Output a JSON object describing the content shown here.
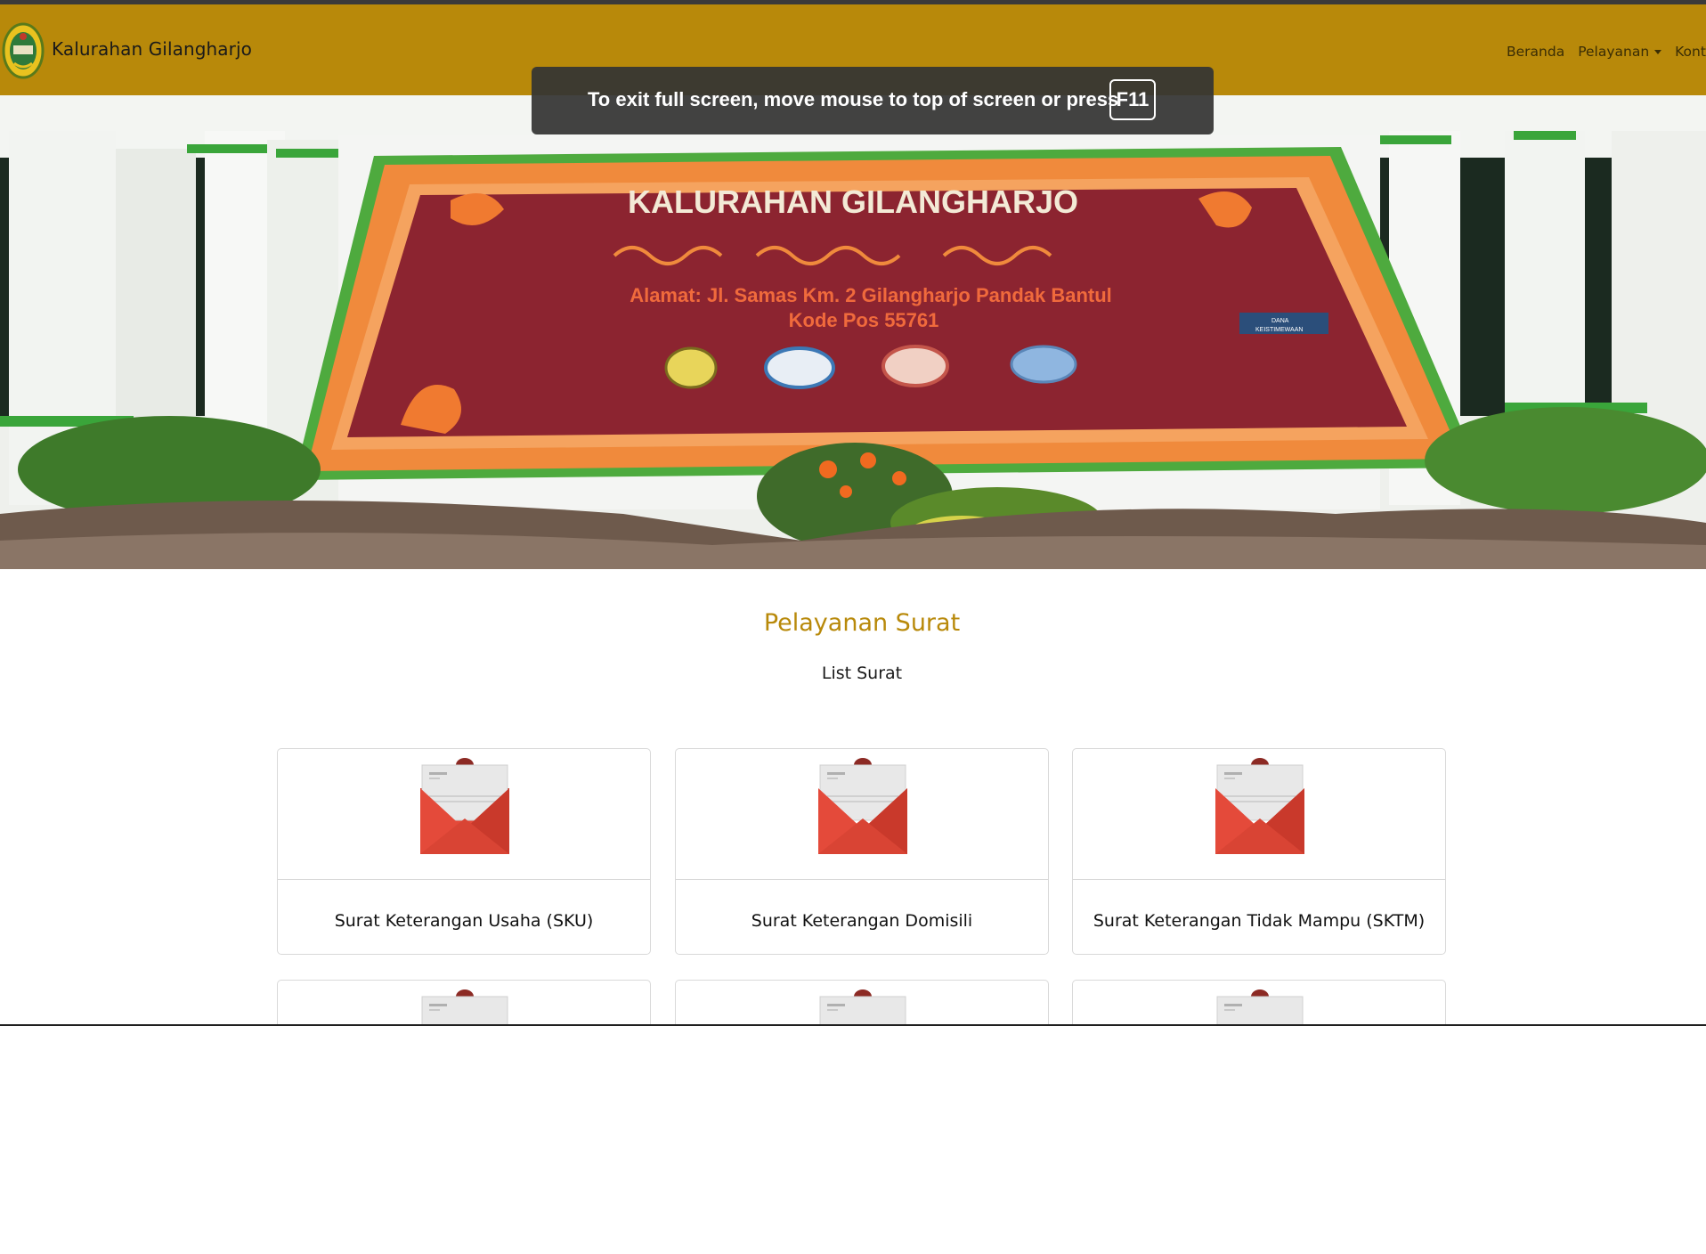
{
  "browser": {
    "fullscreen_notice": {
      "message": "To exit full screen, move mouse to top of screen or press",
      "key": "F11"
    }
  },
  "navbar": {
    "brand": "Kalurahan Gilangharjo",
    "background_color": "#b8890a",
    "links": [
      {
        "label": "Beranda"
      },
      {
        "label": "Pelayanan",
        "dropdown": true
      },
      {
        "label": "Konta"
      }
    ]
  },
  "hero": {
    "sign_title": "KALURAHAN GILANGHARJO",
    "sign_address": "Alamat: Jl. Samas Km. 2 Gilangharjo Pandak Bantul",
    "sign_postcode": "Kode Pos 55761",
    "sign_badge_line1": "DANA",
    "sign_badge_line2": "KEISTIMEWAAN"
  },
  "main": {
    "title": "Pelayanan Surat",
    "subtitle": "List Surat",
    "accent_color": "#b8890a",
    "cards": [
      {
        "title": "Surat Keterangan Usaha (SKU)",
        "icon": "envelope-letter-icon"
      },
      {
        "title": "Surat Keterangan Domisili",
        "icon": "envelope-letter-icon"
      },
      {
        "title": "Surat Keterangan Tidak Mampu (SKTM)",
        "icon": "envelope-letter-icon"
      }
    ],
    "partial_cards_count": 3
  }
}
